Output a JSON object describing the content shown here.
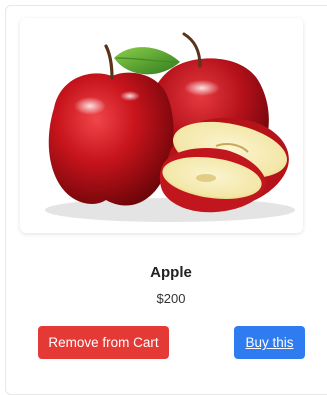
{
  "product": {
    "image_alt": "Apple",
    "title": "Apple",
    "price": "$200"
  },
  "actions": {
    "remove_label": "Remove from Cart",
    "buy_label": "Buy this"
  },
  "colors": {
    "remove": "#e53935",
    "buy": "#2f7bf0"
  }
}
